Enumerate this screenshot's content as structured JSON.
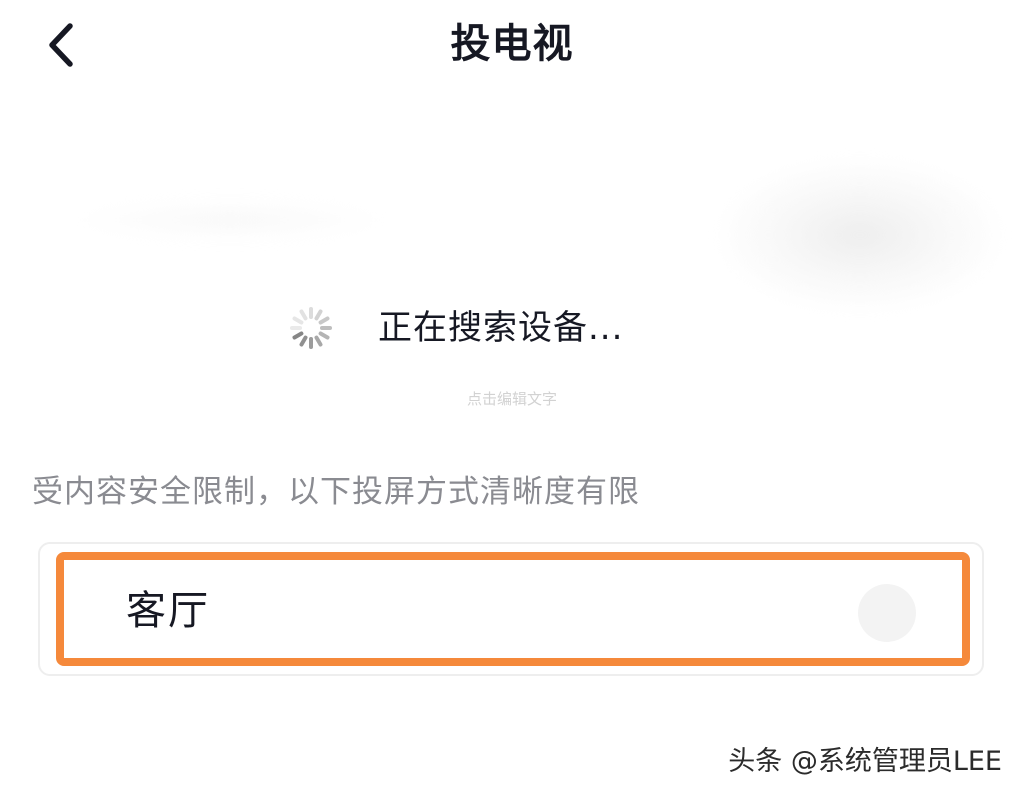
{
  "header": {
    "title": "投电视",
    "back_icon": "chevron-left-icon"
  },
  "status": {
    "spinner_icon": "loading-spinner-icon",
    "searching_text": "正在搜索设备..."
  },
  "overlay_hint": "点击编辑文字",
  "restriction_note": "受内容安全限制，以下投屏方式清晰度有限",
  "devices": [
    {
      "name": "客厅",
      "selected": false,
      "highlight_color": "#f5893b"
    }
  ],
  "watermark": "头条 @系统管理员LEE",
  "colors": {
    "text_primary": "#161823",
    "text_secondary": "#8a8b91",
    "highlight": "#f5893b"
  }
}
